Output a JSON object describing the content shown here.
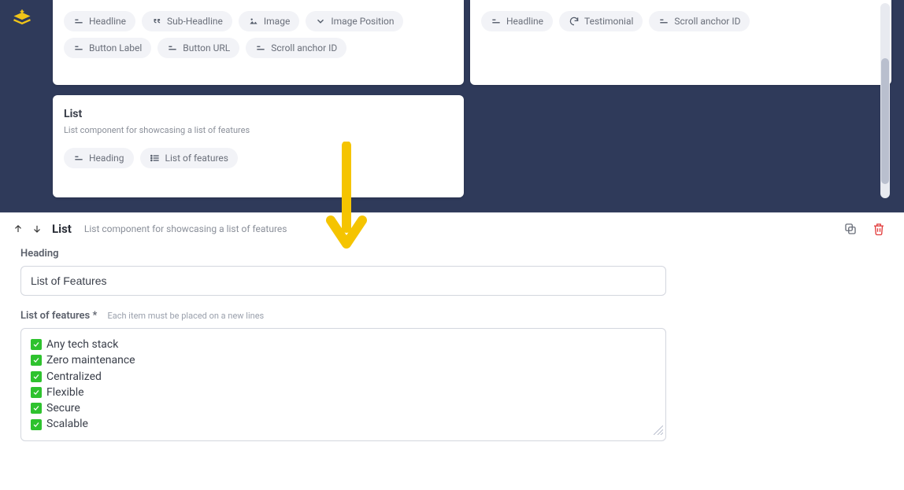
{
  "topCards": {
    "leftTop": {
      "pillsRow1": [
        {
          "icon": "lines",
          "label": "Headline"
        },
        {
          "icon": "quote",
          "label": "Sub-Headline"
        },
        {
          "icon": "image",
          "label": "Image"
        },
        {
          "icon": "chevron",
          "label": "Image Position"
        }
      ],
      "pillsRow2": [
        {
          "icon": "lines",
          "label": "Button Label"
        },
        {
          "icon": "lines",
          "label": "Button URL"
        },
        {
          "icon": "lines",
          "label": "Scroll anchor ID"
        }
      ]
    },
    "rightTop": {
      "pills": [
        {
          "icon": "lines",
          "label": "Headline"
        },
        {
          "icon": "reload",
          "label": "Testimonial"
        },
        {
          "icon": "lines",
          "label": "Scroll anchor ID"
        }
      ]
    },
    "listCard": {
      "title": "List",
      "subtitle": "List component for showcasing a list of features",
      "pills": [
        {
          "icon": "lines",
          "label": "Heading"
        },
        {
          "icon": "list",
          "label": "List of features"
        }
      ]
    }
  },
  "editor": {
    "title": "List",
    "description": "List component for showcasing a list of features",
    "heading": {
      "label": "Heading",
      "value": "List of Features"
    },
    "features": {
      "label": "List of features",
      "required": "*",
      "hint": "Each item must be placed on a new lines",
      "items": [
        "Any tech stack",
        "Zero maintenance",
        "Centralized",
        "Flexible",
        "Secure",
        "Scalable"
      ]
    }
  }
}
